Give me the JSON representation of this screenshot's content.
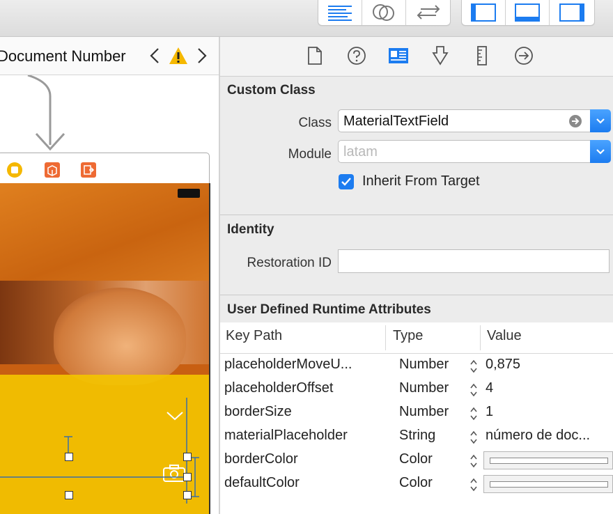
{
  "scene": {
    "title": "Document Number"
  },
  "inspector": {
    "custom_class": {
      "title": "Custom Class",
      "class_label": "Class",
      "class_value": "MaterialTextField",
      "module_label": "Module",
      "module_placeholder": "latam",
      "inherit_label": "Inherit From Target",
      "inherit_checked": true
    },
    "identity": {
      "title": "Identity",
      "restoration_label": "Restoration ID",
      "restoration_value": ""
    },
    "runtime": {
      "title": "User Defined Runtime Attributes",
      "headers": {
        "key_path": "Key Path",
        "type": "Type",
        "value": "Value"
      },
      "rows": [
        {
          "key": "placeholderMoveU...",
          "type": "Number",
          "value": "0,875"
        },
        {
          "key": "placeholderOffset",
          "type": "Number",
          "value": "4"
        },
        {
          "key": "borderSize",
          "type": "Number",
          "value": "1"
        },
        {
          "key": "materialPlaceholder",
          "type": "String",
          "value": "número de doc..."
        },
        {
          "key": "borderColor",
          "type": "Color",
          "value": ""
        },
        {
          "key": "defaultColor",
          "type": "Color",
          "value": ""
        }
      ]
    }
  },
  "colors": {
    "accent": "#1c7cf0",
    "photo_orange": "#d9741a",
    "overlay_yellow": "#f3c300",
    "scene_icon_orange": "#ee6a33",
    "scene_icon_yellow": "#f5b800"
  }
}
